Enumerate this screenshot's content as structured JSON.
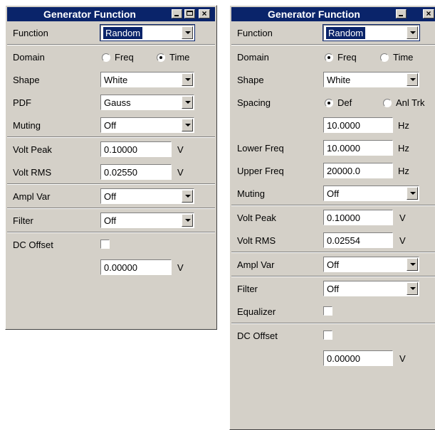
{
  "colors": {
    "title_bar": "#0a246a",
    "panel_bg": "#d4d0c8",
    "field_bg": "#ffffff"
  },
  "left": {
    "title": "Generator Function",
    "buttons": [
      "minimize-icon",
      "maximize-icon",
      "close-icon"
    ],
    "function": {
      "label": "Function",
      "value": "Random"
    },
    "domain": {
      "label": "Domain",
      "opt1": "Freq",
      "opt2": "Time",
      "selected": "Time"
    },
    "shape": {
      "label": "Shape",
      "value": "White"
    },
    "pdf": {
      "label": "PDF",
      "value": "Gauss"
    },
    "muting": {
      "label": "Muting",
      "value": "Off"
    },
    "volt_peak": {
      "label": "Volt Peak",
      "value": "0.10000",
      "unit": "V"
    },
    "volt_rms": {
      "label": "Volt RMS",
      "value": "0.02550",
      "unit": "V"
    },
    "ampl_var": {
      "label": "Ampl Var",
      "value": "Off"
    },
    "filter": {
      "label": "Filter",
      "value": "Off"
    },
    "dc_offset": {
      "label": "DC Offset",
      "checked": false,
      "value": "0.00000",
      "unit": "V"
    }
  },
  "right": {
    "title": "Generator Function",
    "function": {
      "label": "Function",
      "value": "Random"
    },
    "domain": {
      "label": "Domain",
      "opt1": "Freq",
      "opt2": "Time",
      "selected": "Freq"
    },
    "shape": {
      "label": "Shape",
      "value": "White"
    },
    "spacing": {
      "label": "Spacing",
      "opt1": "Def",
      "opt2": "Anl Trk",
      "selected": "Def",
      "value": "10.0000",
      "unit": "Hz"
    },
    "lower_freq": {
      "label": "Lower Freq",
      "value": "10.0000",
      "unit": "Hz"
    },
    "upper_freq": {
      "label": "Upper Freq",
      "value": "20000.0",
      "unit": "Hz"
    },
    "muting": {
      "label": "Muting",
      "value": "Off"
    },
    "volt_peak": {
      "label": "Volt Peak",
      "value": "0.10000",
      "unit": "V"
    },
    "volt_rms": {
      "label": "Volt RMS",
      "value": "0.02554",
      "unit": "V"
    },
    "ampl_var": {
      "label": "Ampl Var",
      "value": "Off"
    },
    "filter": {
      "label": "Filter",
      "value": "Off"
    },
    "equalizer": {
      "label": "Equalizer",
      "checked": false
    },
    "dc_offset": {
      "label": "DC Offset",
      "checked": false,
      "value": "0.00000",
      "unit": "V"
    }
  }
}
